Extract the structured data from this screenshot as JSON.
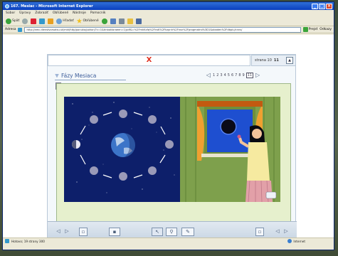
{
  "window": {
    "title": "167. Mesiac - Microsoft Internet Explorer",
    "min_label": "_",
    "max_label": "□",
    "close_label": "×"
  },
  "menu": [
    "Súbor",
    "Úpravy",
    "Zobraziť",
    "Obľúbené",
    "Nástroje",
    "Pomocník"
  ],
  "toolbar": {
    "back_label": "Späť",
    "search_label": "Hľadať",
    "favorites_label": "Obľúbené"
  },
  "address": {
    "label": "Adresa",
    "url": "http://amc.dienstvorsatsu.sk/mkt/http/ponuka/pohon/?c=1&tinbokloraeen=1/pdf&=%2FmkKxfq%2FnsK%2Fkzpnh%2Fnsn%2Fprogmatrsi%3D1&obaden%2Fdbpiu/cnns/",
    "go_label": "Prejsť",
    "links_label": "Odkazy"
  },
  "lesson": {
    "close_x": "X",
    "page_label": "strana 10",
    "page_num": "11",
    "heading": "Fázy Mesiaca",
    "pages": [
      "1",
      "2",
      "3",
      "4",
      "5",
      "6",
      "7",
      "8",
      "9",
      "11"
    ],
    "current_page": "11"
  },
  "statusbar": {
    "text": "Hotovo; 19 strany 300",
    "zone": "Internet"
  },
  "colors": {
    "space": "#0d1f6a",
    "moon_phase": "#9a9ab8",
    "room_wall": "#7ea04c",
    "curtain": "#f0a030",
    "accent_red": "#e03020"
  }
}
